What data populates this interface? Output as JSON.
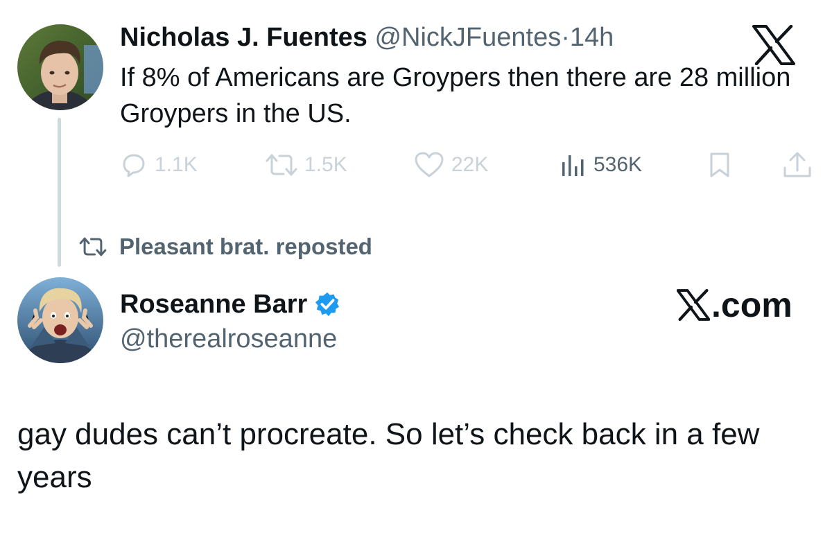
{
  "tweet1": {
    "author_name": "Nicholas J. Fuentes",
    "handle": "@NickJFuentes",
    "separator": "·",
    "time": "14h",
    "text": "If 8% of Americans are Groypers then there are 28 million Groypers in the US.",
    "actions": {
      "replies": "1.1K",
      "reposts": "1.5K",
      "likes": "22K",
      "views": "536K"
    },
    "icons": [
      "reply-icon",
      "repost-icon",
      "like-icon",
      "views-icon",
      "bookmark-icon",
      "share-icon"
    ]
  },
  "repost_banner": {
    "text": "Pleasant brat. reposted",
    "icon": "repost-icon"
  },
  "tweet2": {
    "author_name": "Roseanne Barr",
    "verified": true,
    "handle": "@therealroseanne",
    "text": "gay dudes can’t procreate. So let’s check back in a few years"
  },
  "watermark": {
    "logo_letter": "X",
    "text": ".com"
  },
  "colors": {
    "text_primary": "#0f1419",
    "text_secondary": "#536471",
    "muted_icon": "#c9d2d8",
    "thread_line": "#cfd9de",
    "verified_blue": "#1d9bf0"
  }
}
